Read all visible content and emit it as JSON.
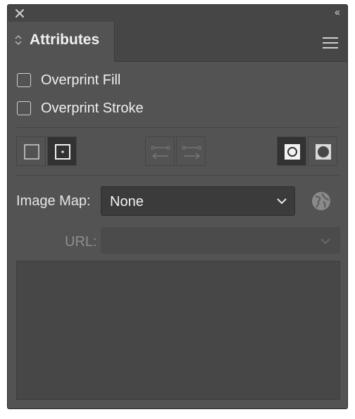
{
  "panel": {
    "tab_label": "Attributes"
  },
  "checkboxes": [
    {
      "label": "Overprint Fill",
      "checked": false
    },
    {
      "label": "Overprint Stroke",
      "checked": false
    }
  ],
  "image_map": {
    "label": "Image Map:",
    "value": "None"
  },
  "url": {
    "label": "URL:",
    "value": ""
  },
  "colors": {
    "panel_bg": "#535353",
    "titlebar_bg": "#464646",
    "active_button_bg": "#323232",
    "text": "#efefef"
  }
}
